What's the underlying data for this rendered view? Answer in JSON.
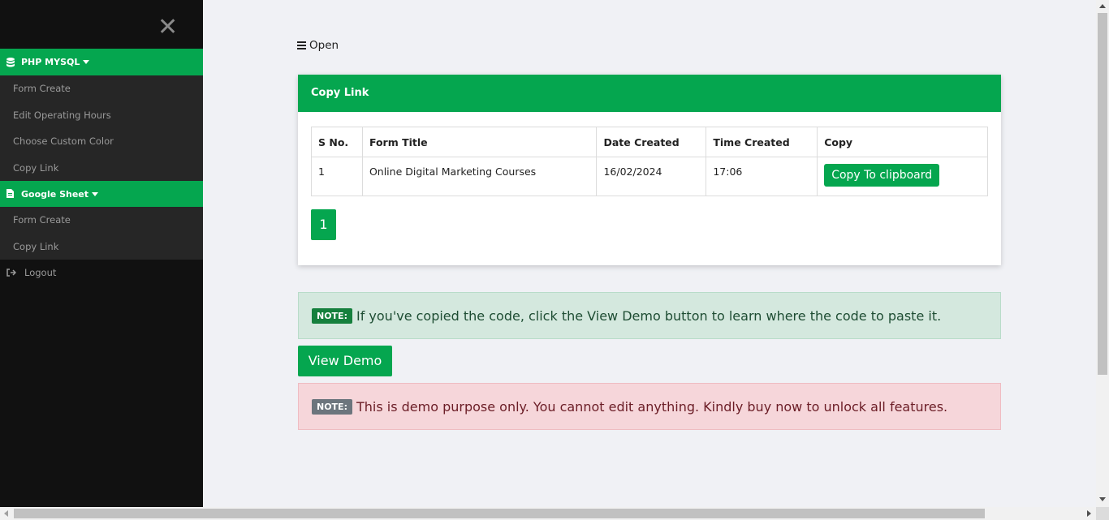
{
  "sidebar": {
    "close_symbol": "✕",
    "sections": [
      {
        "title": "PHP MYSQL",
        "icon": "database-icon",
        "items": [
          "Form Create",
          "Edit Operating Hours",
          "Choose Custom Color",
          "Copy Link"
        ]
      },
      {
        "title": "Google Sheet",
        "icon": "file-icon",
        "items": [
          "Form Create",
          "Copy Link"
        ]
      }
    ],
    "logout_label": "Logout"
  },
  "toolbar": {
    "open_label": "Open"
  },
  "card": {
    "header": "Copy Link",
    "table": {
      "columns": [
        "S No.",
        "Form Title",
        "Date Created",
        "Time Created",
        "Copy"
      ],
      "rows": [
        {
          "sno": "1",
          "title": "Online Digital Marketing Courses",
          "date": "16/02/2024",
          "time": "17:06",
          "copy_label": "Copy To clipboard"
        }
      ]
    },
    "pagination": {
      "current_page": "1"
    }
  },
  "alerts": {
    "success": {
      "badge": "NOTE:",
      "text": "If you've copied the code, click the View Demo button to learn where the code to paste it."
    },
    "danger": {
      "badge": "NOTE:",
      "text": "This is demo purpose only. You cannot edit anything. Kindly buy now to unlock all features."
    }
  },
  "view_demo_label": "View Demo",
  "colors": {
    "brand_green": "#05a64f",
    "sidebar_bg": "#111111",
    "submenu_bg": "#262626"
  }
}
